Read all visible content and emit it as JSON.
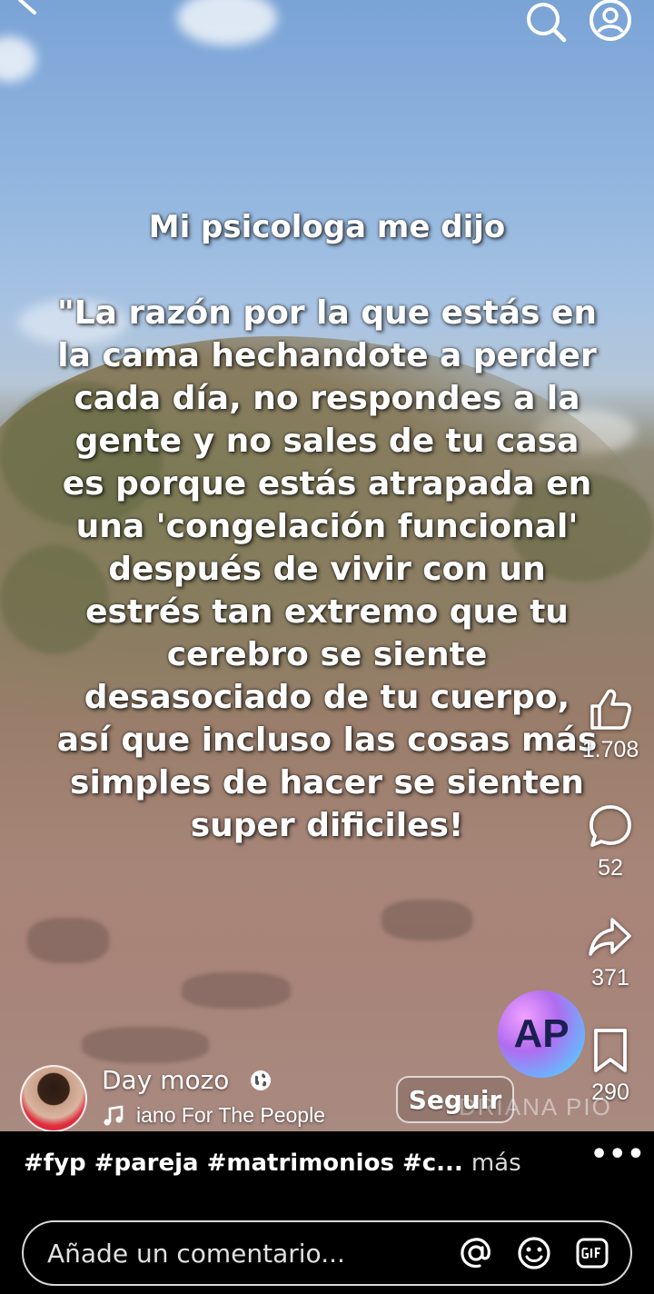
{
  "overlay": {
    "title": "Mi psicologa me dijo",
    "body": "\"La razón por la que estás en\nla cama hechandote a perder\ncada día, no respondes a la\ngente y no sales de tu casa\nes porque estás atrapada en\nuna 'congelación funcional'\ndespués de vivir con un\nestrés tan extremo que tu\ncerebro se siente\ndesasociado de tu cuerpo,\nasí que incluso las cosas más\nsimples de hacer se sienten\nsuper dificiles!"
  },
  "top_bar": {
    "icons": [
      "back-icon",
      "search-icon",
      "profile-icon"
    ]
  },
  "actions": {
    "likes": "1.708",
    "comments": "52",
    "shares": "371",
    "saves": "290"
  },
  "author": {
    "username": "Day mozo",
    "sound": "iano For The People",
    "follow_label": "Seguir"
  },
  "watermark": {
    "logo_text": "AP",
    "text": "DRIANA PIO"
  },
  "caption": {
    "text": "#fyp #pareja #matrimonios #c...",
    "more": "más"
  },
  "more_options": "•••",
  "comment_input": {
    "placeholder": "Añade un comentario..."
  },
  "colors": {
    "background": "#000000",
    "text": "#ffffff"
  }
}
